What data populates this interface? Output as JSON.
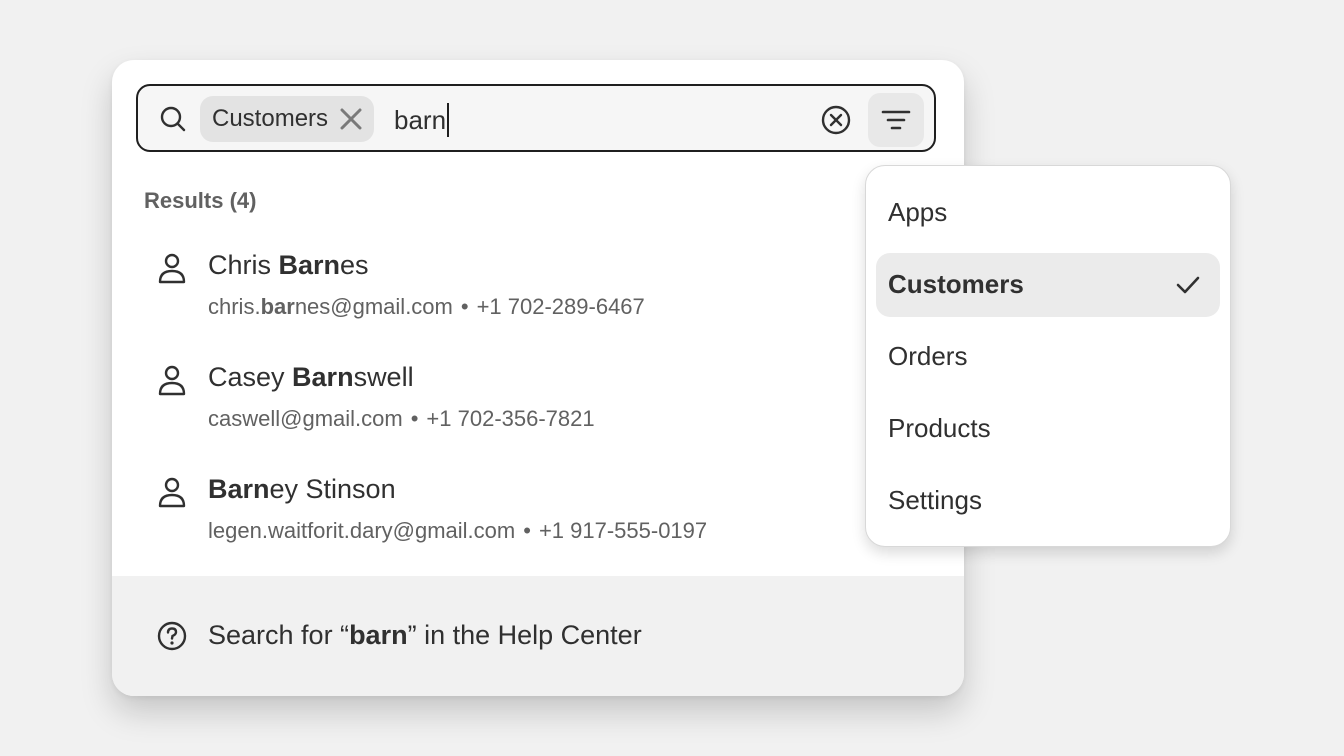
{
  "search": {
    "scope_chip": "Customers",
    "query": "barn"
  },
  "results": {
    "title": "Results (4)",
    "items": [
      {
        "name_pre": "Chris ",
        "name_bold": "Barn",
        "name_post": "es",
        "email_pre": "chris.",
        "email_bold": "bar",
        "email_post": "nes@gmail.com",
        "separator": "•",
        "phone": "+1 702-289-6467"
      },
      {
        "name_pre": "Casey ",
        "name_bold": "Barn",
        "name_post": "swell",
        "email_pre": "caswell@gmail.com",
        "email_bold": "",
        "email_post": "",
        "separator": "•",
        "phone": "+1 702-356-7821"
      },
      {
        "name_pre": "",
        "name_bold": "Barn",
        "name_post": "ey Stinson",
        "email_pre": "legen.waitforit.dary@gmail.com",
        "email_bold": "",
        "email_post": "",
        "separator": "•",
        "phone": "+1 917-555-0197"
      }
    ]
  },
  "footer": {
    "prefix": "Search for “",
    "query": "barn",
    "suffix": "” in the Help Center"
  },
  "filter_menu": {
    "items": [
      {
        "label": "Apps",
        "selected": false
      },
      {
        "label": "Customers",
        "selected": true
      },
      {
        "label": "Orders",
        "selected": false
      },
      {
        "label": "Products",
        "selected": false
      },
      {
        "label": "Settings",
        "selected": false
      }
    ]
  }
}
